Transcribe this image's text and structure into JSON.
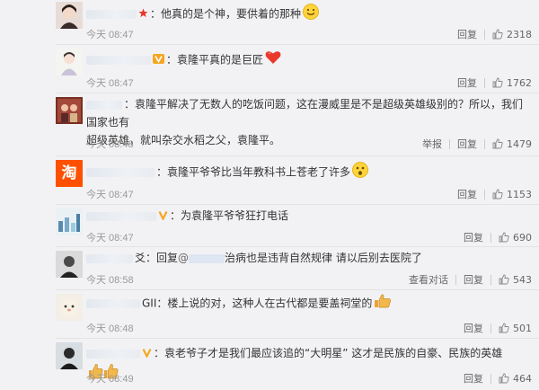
{
  "colors": {
    "background": "#f2f2f5",
    "text": "#333333",
    "muted": "#999999",
    "vip": "#f5a623",
    "star": "#e8392c"
  },
  "comments": [
    {
      "text": "他真的是个神，要供着的那种",
      "time": "今天 08:47",
      "actions": [
        "回复"
      ],
      "likes": "2318"
    },
    {
      "text": "袁隆平真的是巨匠",
      "time": "今天 08:47",
      "actions": [
        "回复"
      ],
      "likes": "1762"
    },
    {
      "text_line1": "袁隆平解决了无数人的吃饭问题，这在漫威里是不是超级英雄级别的？所以，我们国家也有",
      "text_line2": "超级英雄，就叫杂交水稻之父，袁隆平。",
      "time": "今天 08:48",
      "actions": [
        "举报",
        "回复"
      ],
      "likes": "1479"
    },
    {
      "text": "袁隆平爷爷比当年教科书上苍老了许多",
      "time": "今天 08:47",
      "actions": [
        "回复"
      ],
      "likes": "1153",
      "avatar_label": "淘"
    },
    {
      "text": "为袁隆平爷爷狂打电话",
      "time": "今天 08:47",
      "actions": [
        "回复"
      ],
      "likes": "690"
    },
    {
      "name_tail": "爻",
      "reply_prefix": "回复",
      "at": "@",
      "text": "治病也是违背自然规律 请以后别去医院了",
      "time": "今天 08:58",
      "actions": [
        "查看对话",
        "回复"
      ],
      "likes": "543"
    },
    {
      "name_tail": "GII",
      "text": "楼上说的对，这种人在古代都是要盖祠堂的",
      "time": "今天 08:48",
      "actions": [
        "回复"
      ],
      "likes": "501"
    },
    {
      "text": "袁老爷子才是我们最应该追的“大明星” 这才是民族的自豪、民族的英雄",
      "time": "今天 08:49",
      "actions": [
        "回复"
      ],
      "likes": "464"
    }
  ]
}
